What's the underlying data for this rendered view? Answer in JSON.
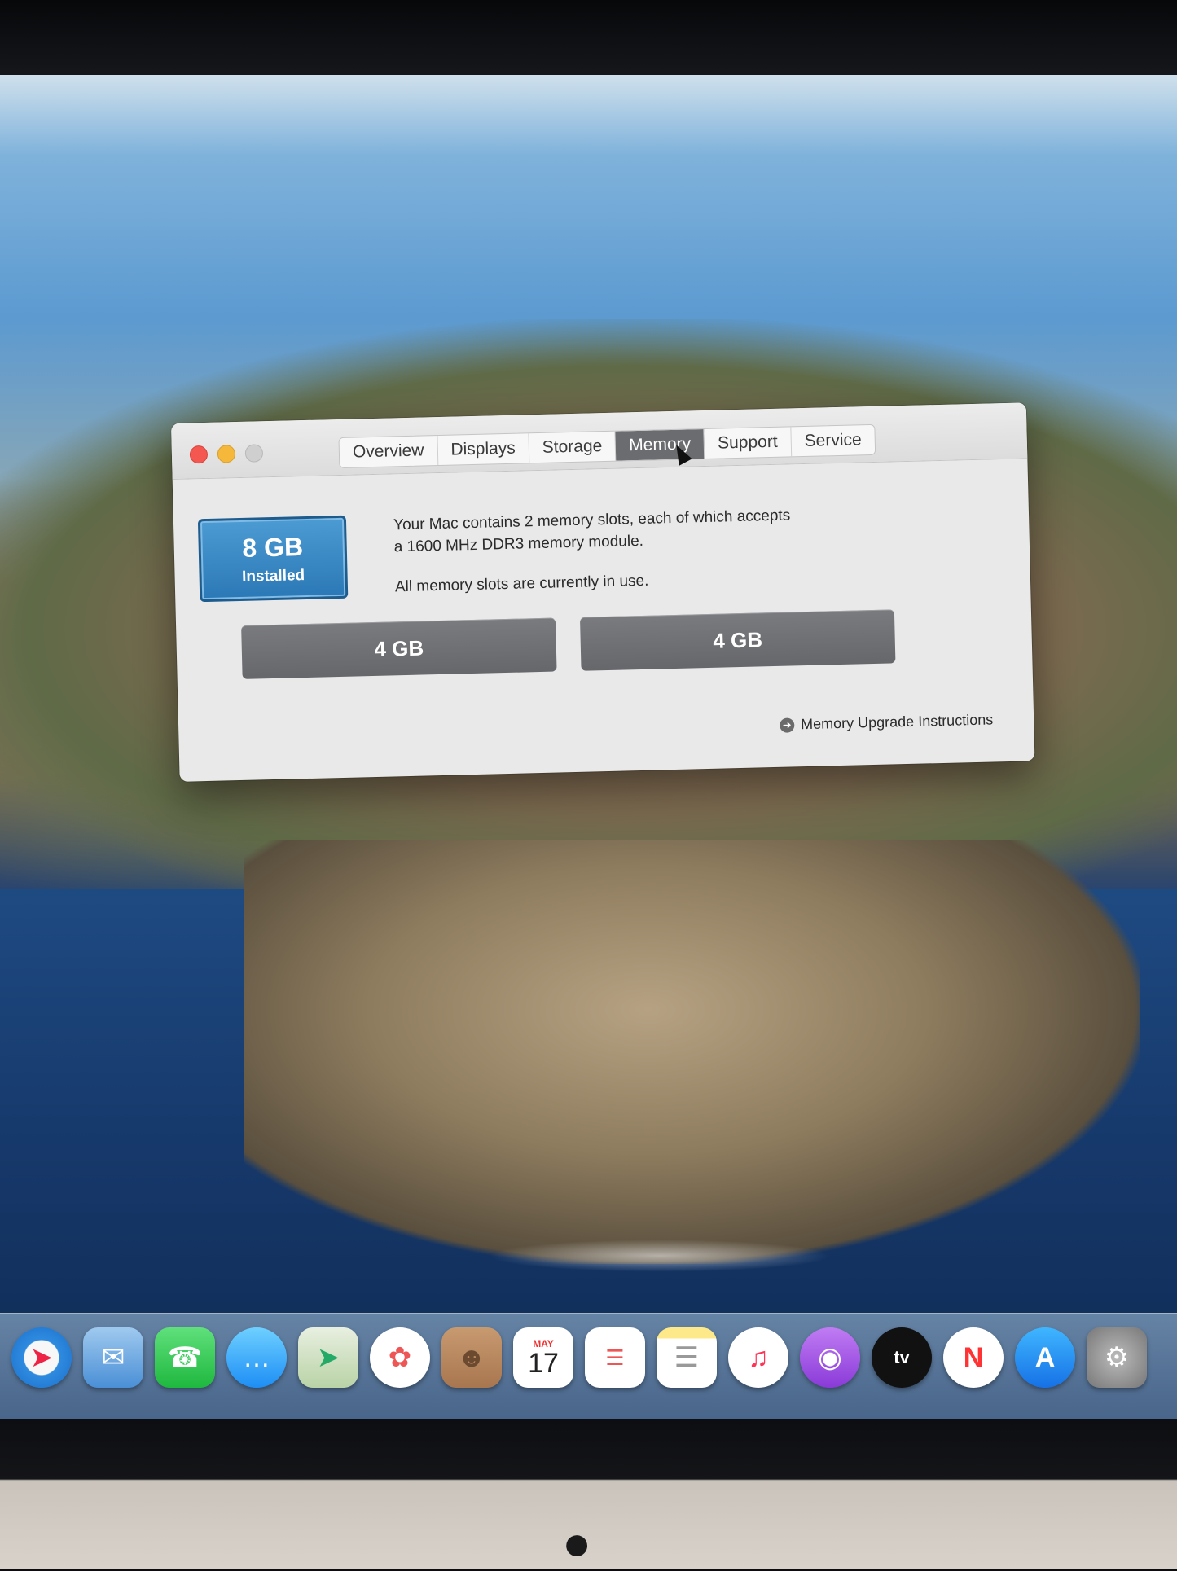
{
  "window": {
    "tabs": [
      {
        "label": "Overview"
      },
      {
        "label": "Displays"
      },
      {
        "label": "Storage"
      },
      {
        "label": "Memory"
      },
      {
        "label": "Support"
      },
      {
        "label": "Service"
      }
    ],
    "active_tab": "Memory"
  },
  "memory": {
    "installed_amount": "8 GB",
    "installed_label": "Installed",
    "description_line1": "Your Mac contains 2 memory slots, each of which accepts",
    "description_line2": "a 1600 MHz DDR3 memory module.",
    "status": "All memory slots are currently in use.",
    "slots": [
      "4 GB",
      "4 GB"
    ],
    "upgrade_link": "Memory Upgrade Instructions"
  },
  "dock": {
    "items": [
      {
        "icon": "safari-icon"
      },
      {
        "icon": "mail-icon"
      },
      {
        "icon": "facetime-icon"
      },
      {
        "icon": "messages-icon"
      },
      {
        "icon": "maps-icon"
      },
      {
        "icon": "photos-icon"
      },
      {
        "icon": "contacts-icon"
      },
      {
        "icon": "calendar-icon",
        "month": "MAY",
        "day": "17"
      },
      {
        "icon": "reminders-icon"
      },
      {
        "icon": "notes-icon"
      },
      {
        "icon": "music-icon"
      },
      {
        "icon": "podcasts-icon"
      },
      {
        "icon": "tv-icon",
        "label": "tv"
      },
      {
        "icon": "news-icon"
      },
      {
        "icon": "app-store-icon"
      },
      {
        "icon": "system-preferences-icon"
      }
    ]
  }
}
